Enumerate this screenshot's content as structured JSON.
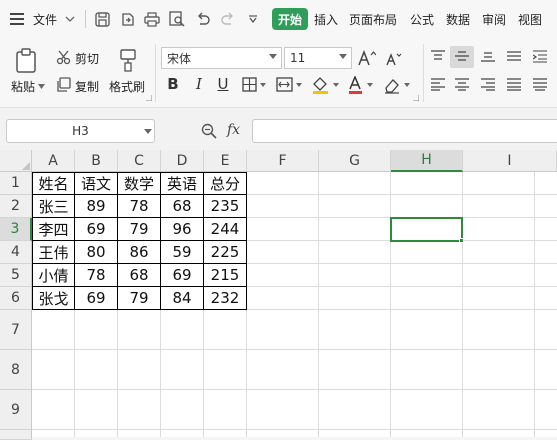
{
  "menubar": {
    "file_label": "文件",
    "start_tab": "开始",
    "tabs": [
      "插入",
      "页面布局",
      "公式",
      "数据",
      "审阅",
      "视图"
    ]
  },
  "ribbon": {
    "paste": "粘贴",
    "cut": "剪切",
    "copy": "复制",
    "format_painter": "格式刷",
    "font_name": "宋体",
    "font_size": "11"
  },
  "formula_bar": {
    "name_box": "H3",
    "fx": "fx",
    "formula": ""
  },
  "sheet": {
    "columns": [
      "A",
      "B",
      "C",
      "D",
      "E",
      "F",
      "G",
      "H",
      "I"
    ],
    "rows": [
      "1",
      "2",
      "3",
      "4",
      "5",
      "6",
      "7",
      "8",
      "9"
    ],
    "active_cell": "H3",
    "cells": [
      [
        "姓名",
        "语文",
        "数学",
        "英语",
        "总分"
      ],
      [
        "张三",
        "89",
        "78",
        "68",
        "235"
      ],
      [
        "李四",
        "69",
        "79",
        "96",
        "244"
      ],
      [
        "王伟",
        "80",
        "86",
        "59",
        "225"
      ],
      [
        "小倩",
        "78",
        "68",
        "69",
        "215"
      ],
      [
        "张戈",
        "69",
        "79",
        "84",
        "232"
      ]
    ]
  }
}
